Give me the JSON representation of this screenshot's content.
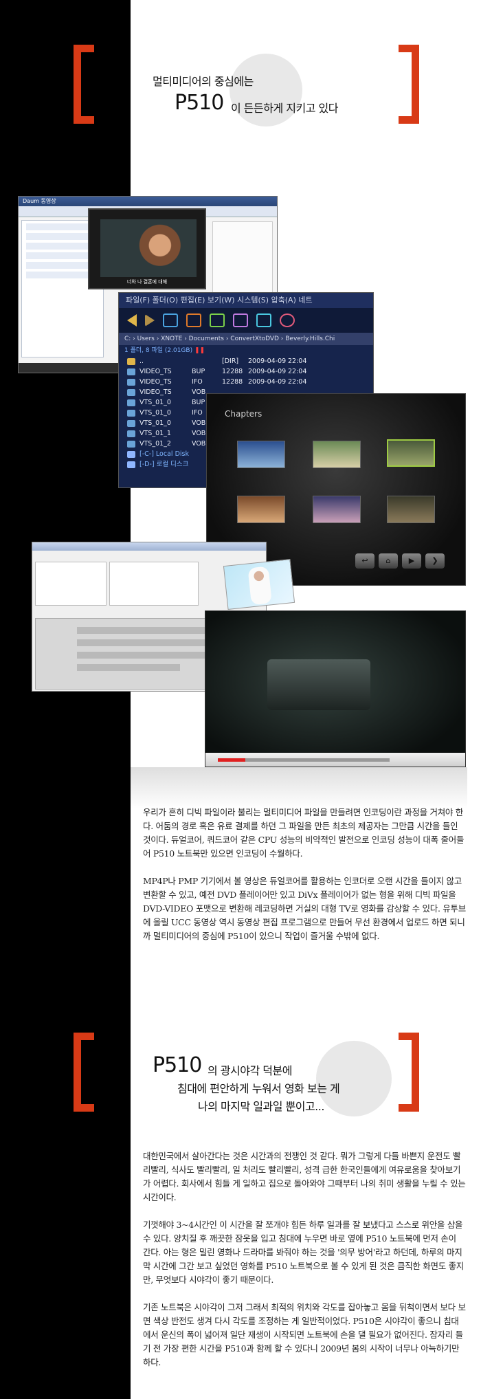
{
  "section1": {
    "intro": "멀티미디어의 중심에는",
    "model": "P510",
    "tail": "이 든든하게 지키고 있다"
  },
  "collage": {
    "window_a": {
      "title": "Daum 동영상",
      "subtitle": "너와 나 결혼에 대해"
    },
    "explorer": {
      "menu": "파일(F)   폴더(O)   편집(E)   보기(W)   시스템(S)   압축(A)   네트",
      "path": "C:  ›  Users  ›  XNOTE  ›  Documents  ›  ConvertXtoDVD  ›  Beverly.Hills.Chi",
      "summary_pre": "1 폴더, 8 파일 (2.01GB)",
      "files": [
        {
          "name": "..",
          "ext": "",
          "size": "[DIR]",
          "date": "2009-04-09",
          "time": "22:04",
          "kind": "folder"
        },
        {
          "name": "VIDEO_TS",
          "ext": "BUP",
          "size": "12288",
          "date": "2009-04-09",
          "time": "22:04",
          "kind": "file"
        },
        {
          "name": "VIDEO_TS",
          "ext": "IFO",
          "size": "12288",
          "date": "2009-04-09",
          "time": "22:04",
          "kind": "file"
        },
        {
          "name": "VIDEO_TS",
          "ext": "VOB",
          "size": "",
          "date": "",
          "time": "",
          "kind": "file"
        },
        {
          "name": "VTS_01_0",
          "ext": "BUP",
          "size": "",
          "date": "",
          "time": "",
          "kind": "file"
        },
        {
          "name": "VTS_01_0",
          "ext": "IFO",
          "size": "",
          "date": "",
          "time": "",
          "kind": "file"
        },
        {
          "name": "VTS_01_0",
          "ext": "VOB",
          "size": "",
          "date": "",
          "time": "",
          "kind": "file"
        },
        {
          "name": "VTS_01_1",
          "ext": "VOB",
          "size": "",
          "date": "",
          "time": "",
          "kind": "file"
        },
        {
          "name": "VTS_01_2",
          "ext": "VOB",
          "size": "",
          "date": "",
          "time": "",
          "kind": "file"
        },
        {
          "name": "[-C-] Local Disk",
          "ext": "",
          "size": "",
          "date": "",
          "time": "",
          "kind": "disk"
        },
        {
          "name": "[-D-] 로컬 디스크",
          "ext": "",
          "size": "",
          "date": "",
          "time": "",
          "kind": "disk"
        }
      ]
    },
    "chapters": {
      "title": "Chapters",
      "nav": [
        "↩",
        "⌂",
        "▶",
        "❯"
      ]
    },
    "colors": {
      "accent": "#d83a16",
      "explorer_bg": "#16244c",
      "selected_thumb": "#9ecb43"
    }
  },
  "text1": {
    "p1": "우리가 흔히 디빅 파일이라 불리는 멀티미디어 파일을 만들려면 인코딩이란 과정을 거쳐야 한다. 어둠의 경로 혹은 유료 결제를 하던 그 파일을 만든 최초의 제공자는 그만큼 시간을 들인 것이다. 듀얼코어, 쿼드코어 같은 CPU 성능의 비약적인 발전으로 인코딩 성능이 대폭 줄어들어 P510 노트북만 있으면 인코딩이 수월하다.",
    "p2": "MP4P나 PMP 기기에서 볼 영상은 듀얼코어를 활용하는 인코더로 오랜 시간을 들이지 않고 변환할 수 있고, 예전 DVD 플레이어만 있고 DiVx 플레이어가 없는 형을 위해 디빅 파일을 DVD-VIDEO 포맷으로 변환해 레코딩하면 거실의 대형 TV로 영화를 감상할 수 있다. 유투브에 올릴 UCC 동영상 역시 동영상 편집 프로그램으로 만들어 무선 환경에서 업로드 하면 되니까 멀티미디어의 중심에 P510이 있으니 작업이 즐거울 수밖에 없다."
  },
  "section2": {
    "model": "P510",
    "line1": "의 광시야각 덕분에",
    "line2": "침대에 편안하게 누워서 영화 보는 게",
    "line3": "나의 마지막 일과일 뿐이고..."
  },
  "text2": {
    "p1": "대한민국에서 살아간다는 것은 시간과의 전쟁인 것 같다. 뭐가 그렇게 다들 바쁜지 운전도 빨리빨리, 식사도 빨리빨리, 일 처리도 빨리빨리, 성격 급한 한국인들에게 여유로움을 찾아보기가 어렵다. 회사에서 힘들 게 일하고 집으로 돌아와야 그때부터 나의 취미 생활을 누릴 수 있는 시간이다.",
    "p2": "기껏해야 3~4시간인 이 시간을 잘 쪼개야 힘든 하루 일과를 잘 보냈다고 스스로 위안을 삼을 수 있다. 양치질 후 깨끗한 잠옷을 입고 침대에 누우면 바로 옆에 P510 노트북에 먼저 손이 간다. 아는 형은 밀린 영화나 드라마를 봐줘야 하는 것을 '의무 방어'라고 하던데, 하루의 마지막 시간에 그간 보고 싶었던 영화를 P510 노트북으로 볼 수 있게 된 것은 큼직한 화면도 좋지만, 무엇보다 시야각이 좋기 때문이다.",
    "p3": "기존 노트북은 시야각이 그저 그래서 최적의 위치와 각도를 잡아놓고 몸을 뒤척이면서 보다 보면 색상 반전도 생겨 다시 각도를 조정하는 게 일반적이었다. P510은 시야각이 좋으니 침대에서 운신의 폭이 넓어져 일단 재생이 시작되면 노트북에 손을 댈 필요가 없어진다. 잠자리 들기 전 가장 편한 시간을 P510과 함께 할 수 있다니 2009년 봄의 시작이 너무나 아늑하기만 하다."
  }
}
